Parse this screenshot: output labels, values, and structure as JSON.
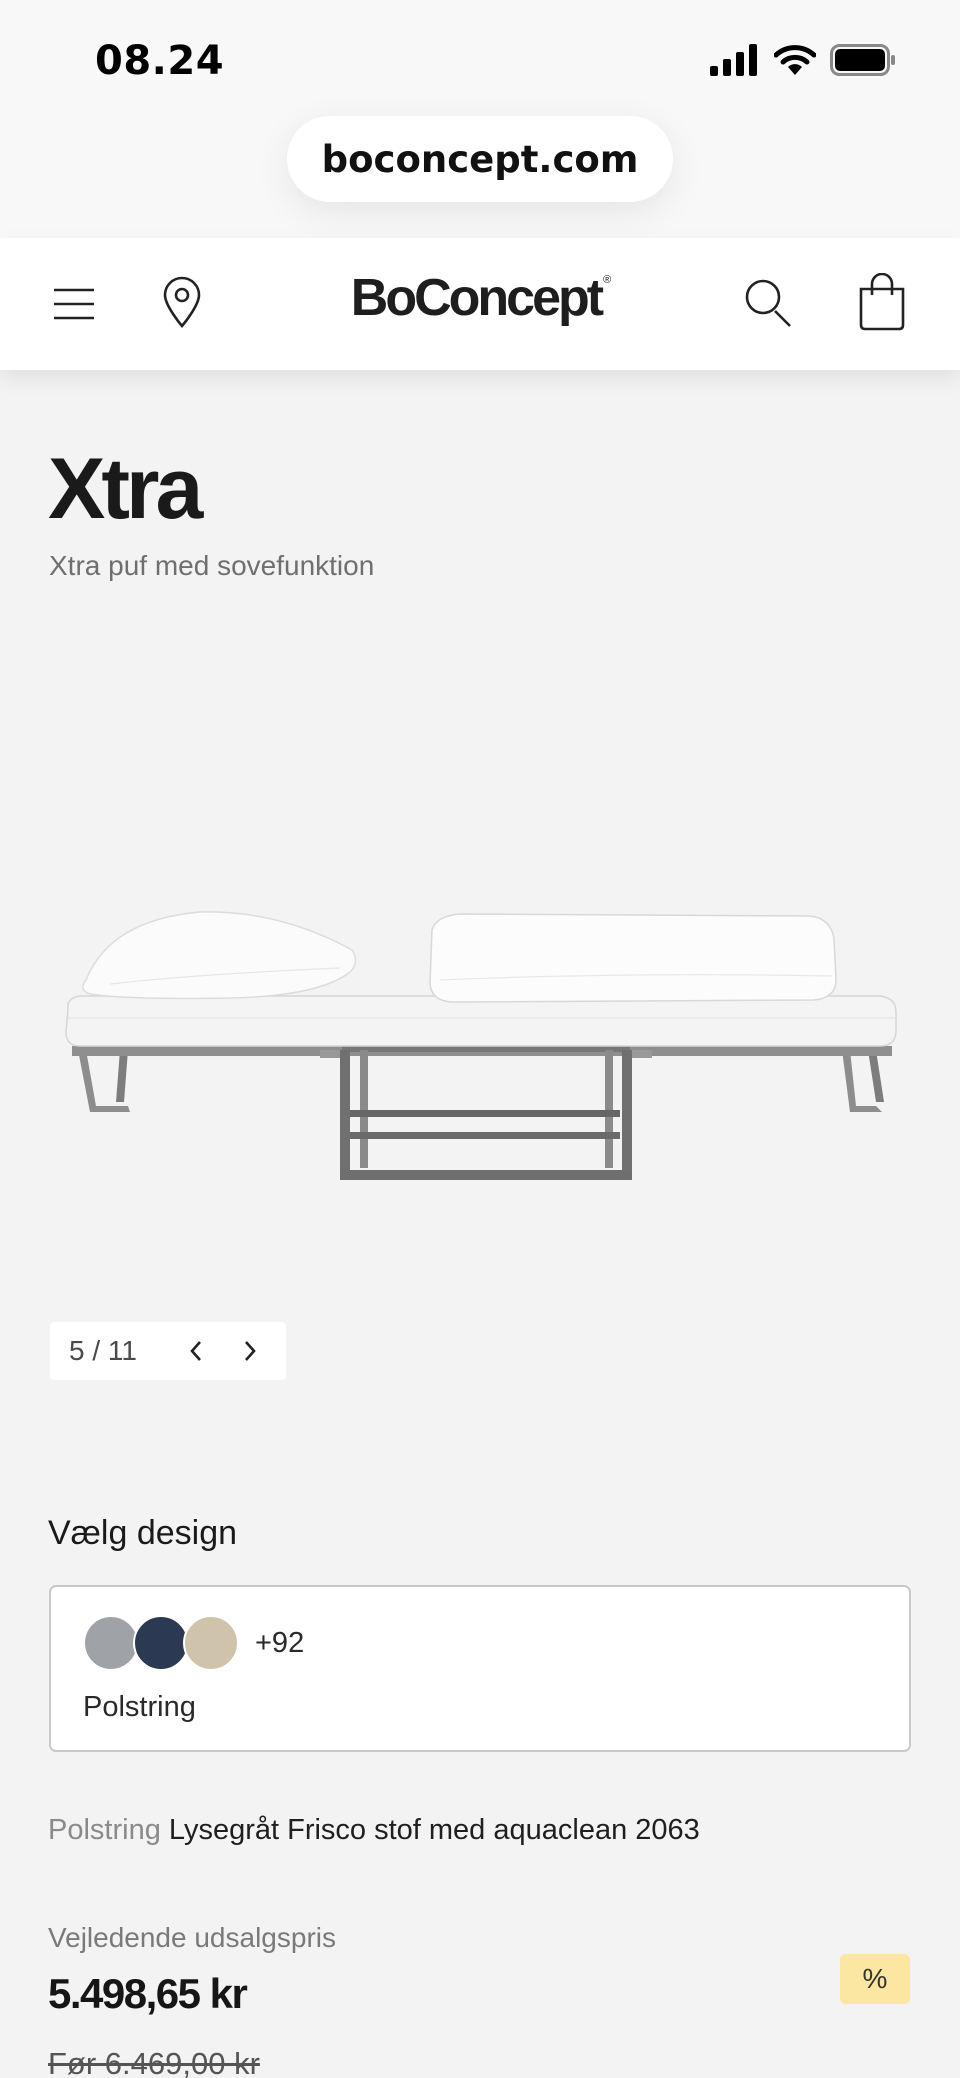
{
  "status_bar": {
    "time": "08.24"
  },
  "browser": {
    "url": "boconcept.com"
  },
  "header": {
    "logo_text": "BoConcept",
    "logo_mark": "®"
  },
  "product": {
    "title": "Xtra",
    "subtitle": "Xtra puf med sovefunktion"
  },
  "gallery": {
    "counter": "5 / 11"
  },
  "design": {
    "label": "Vælg design",
    "more_count": "+92",
    "type_label": "Polstring",
    "swatch_colors": [
      "#9fa2a7",
      "#2b3a52",
      "#cfc3ac"
    ]
  },
  "selection": {
    "key": "Polstring",
    "value": "Lysegråt Frisco stof med aquaclean 2063"
  },
  "pricing": {
    "label": "Vejledende udsalgspris",
    "price": "5.498,65 kr",
    "old_price": "Før 6.469,00 kr",
    "discount_badge": "%",
    "badge_color": "#fbe7a1"
  }
}
